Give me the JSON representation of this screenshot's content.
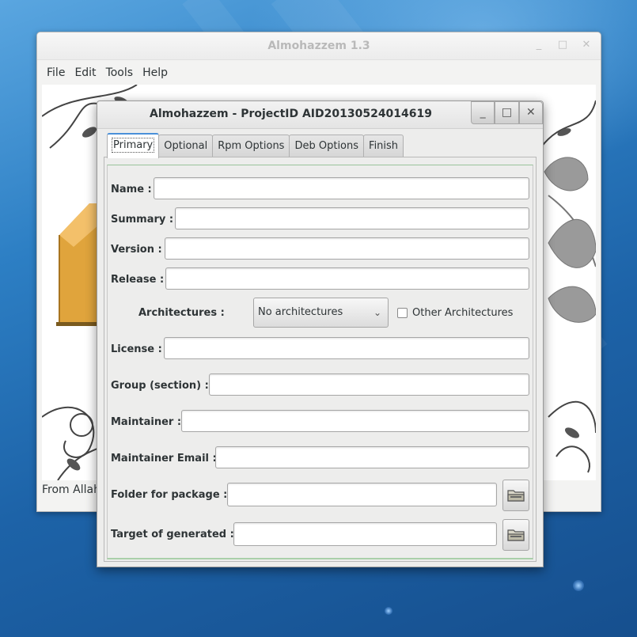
{
  "main_window": {
    "title": "Almohazzem 1.3",
    "menu": [
      "File",
      "Edit",
      "Tools",
      "Help"
    ],
    "status_text": "From Allah",
    "minimize_glyph": "_",
    "maximize_glyph": "□",
    "close_glyph": "✕"
  },
  "dialog": {
    "title": "Almohazzem - ProjectID AID20130524014619",
    "minimize_glyph": "_",
    "maximize_glyph": "□",
    "close_glyph": "✕",
    "tabs": [
      {
        "label": "Primary",
        "active": true
      },
      {
        "label": "Optional",
        "active": false
      },
      {
        "label": "Rpm Options",
        "active": false
      },
      {
        "label": "Deb Options",
        "active": false
      },
      {
        "label": "Finish",
        "active": false
      }
    ]
  },
  "form": {
    "name_label": "Name :",
    "name_value": "",
    "summary_label": "Summary :",
    "summary_value": "",
    "version_label": "Version :",
    "version_value": "",
    "release_label": "Release :",
    "release_value": "",
    "architectures_label": "Architectures :",
    "architectures_selected": "No architectures",
    "other_arch_label": "Other Architectures",
    "other_arch_checked": false,
    "license_label": "License :",
    "license_value": "",
    "group_label": "Group (section) :",
    "group_value": "",
    "maintainer_label": "Maintainer :",
    "maintainer_value": "",
    "maintainer_email_label": "Maintainer Email :",
    "maintainer_email_value": "",
    "folder_label": "Folder for package :",
    "folder_value": "",
    "target_label": "Target of generated :",
    "target_value": ""
  },
  "icons": {
    "folder_browse": "folder-icon",
    "combo_arrow": "chevron-down-icon"
  },
  "colors": {
    "desktop_blue": "#1d63a8",
    "active_tab_accent": "#4a90d9",
    "dialog_bg": "#ededec"
  }
}
